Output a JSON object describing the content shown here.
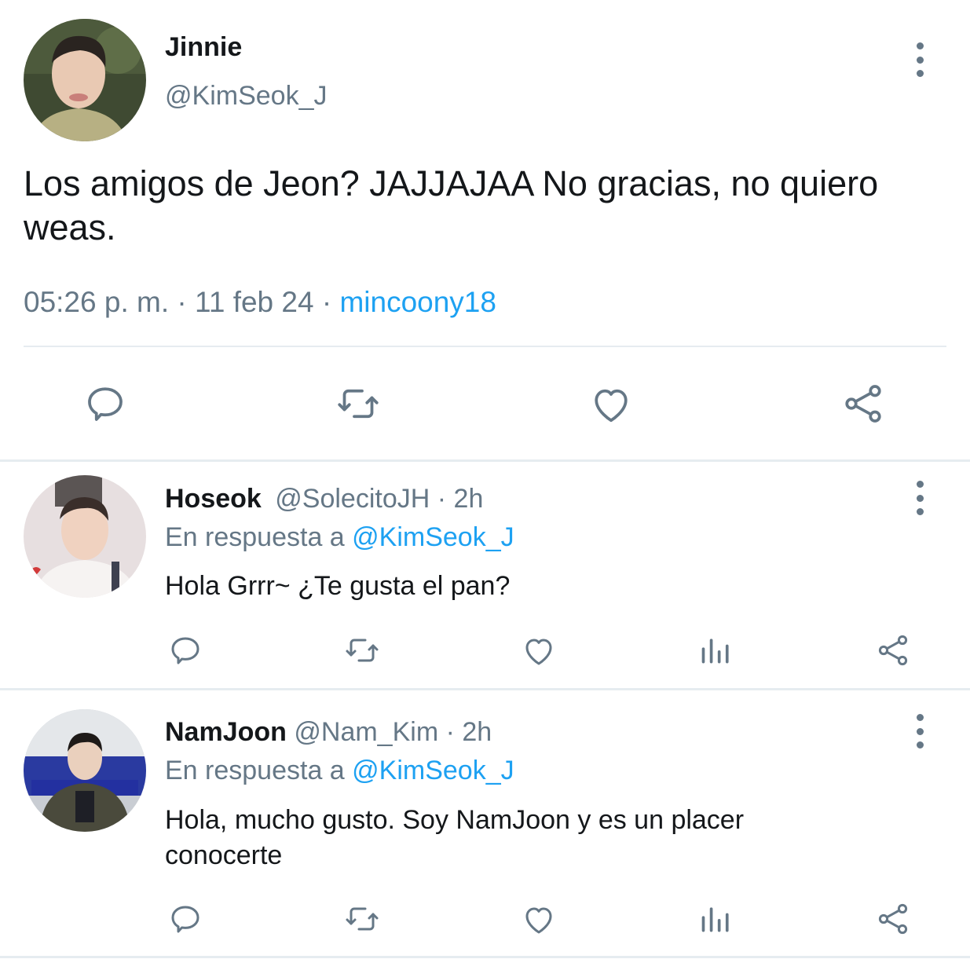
{
  "main_tweet": {
    "display_name": "Jinnie",
    "handle": "@KimSeok_J",
    "text": "Los amigos de Jeon? JAJJAJAA No gracias, no quiero weas.",
    "time": "05:26 p. m.",
    "separator1": "·",
    "date": "11 feb 24",
    "separator2": "·",
    "source": "mincoony18",
    "avatar_icon": "avatar-photo",
    "actions": [
      "reply-icon",
      "retweet-icon",
      "like-icon",
      "share-icon"
    ]
  },
  "replies": [
    {
      "display_name": "Hoseok",
      "handle": "@SolecitoJH",
      "age": "· 2h",
      "reply_prefix": "En respuesta a",
      "reply_to": "@KimSeok_J",
      "text": "Hola Grrr~ ¿Te gusta el pan?"
    },
    {
      "display_name": "NamJoon",
      "handle": "@Nam_Kim",
      "age": "· 2h",
      "reply_prefix": "En respuesta a",
      "reply_to": "@KimSeok_J",
      "text_line1": "Hola, mucho gusto. Soy NamJoon y es un placer",
      "text_line2": "conocerte"
    }
  ],
  "colors": {
    "text": "#14171a",
    "muted": "#657786",
    "link": "#1da1f2",
    "divider": "#e6ecf0"
  }
}
